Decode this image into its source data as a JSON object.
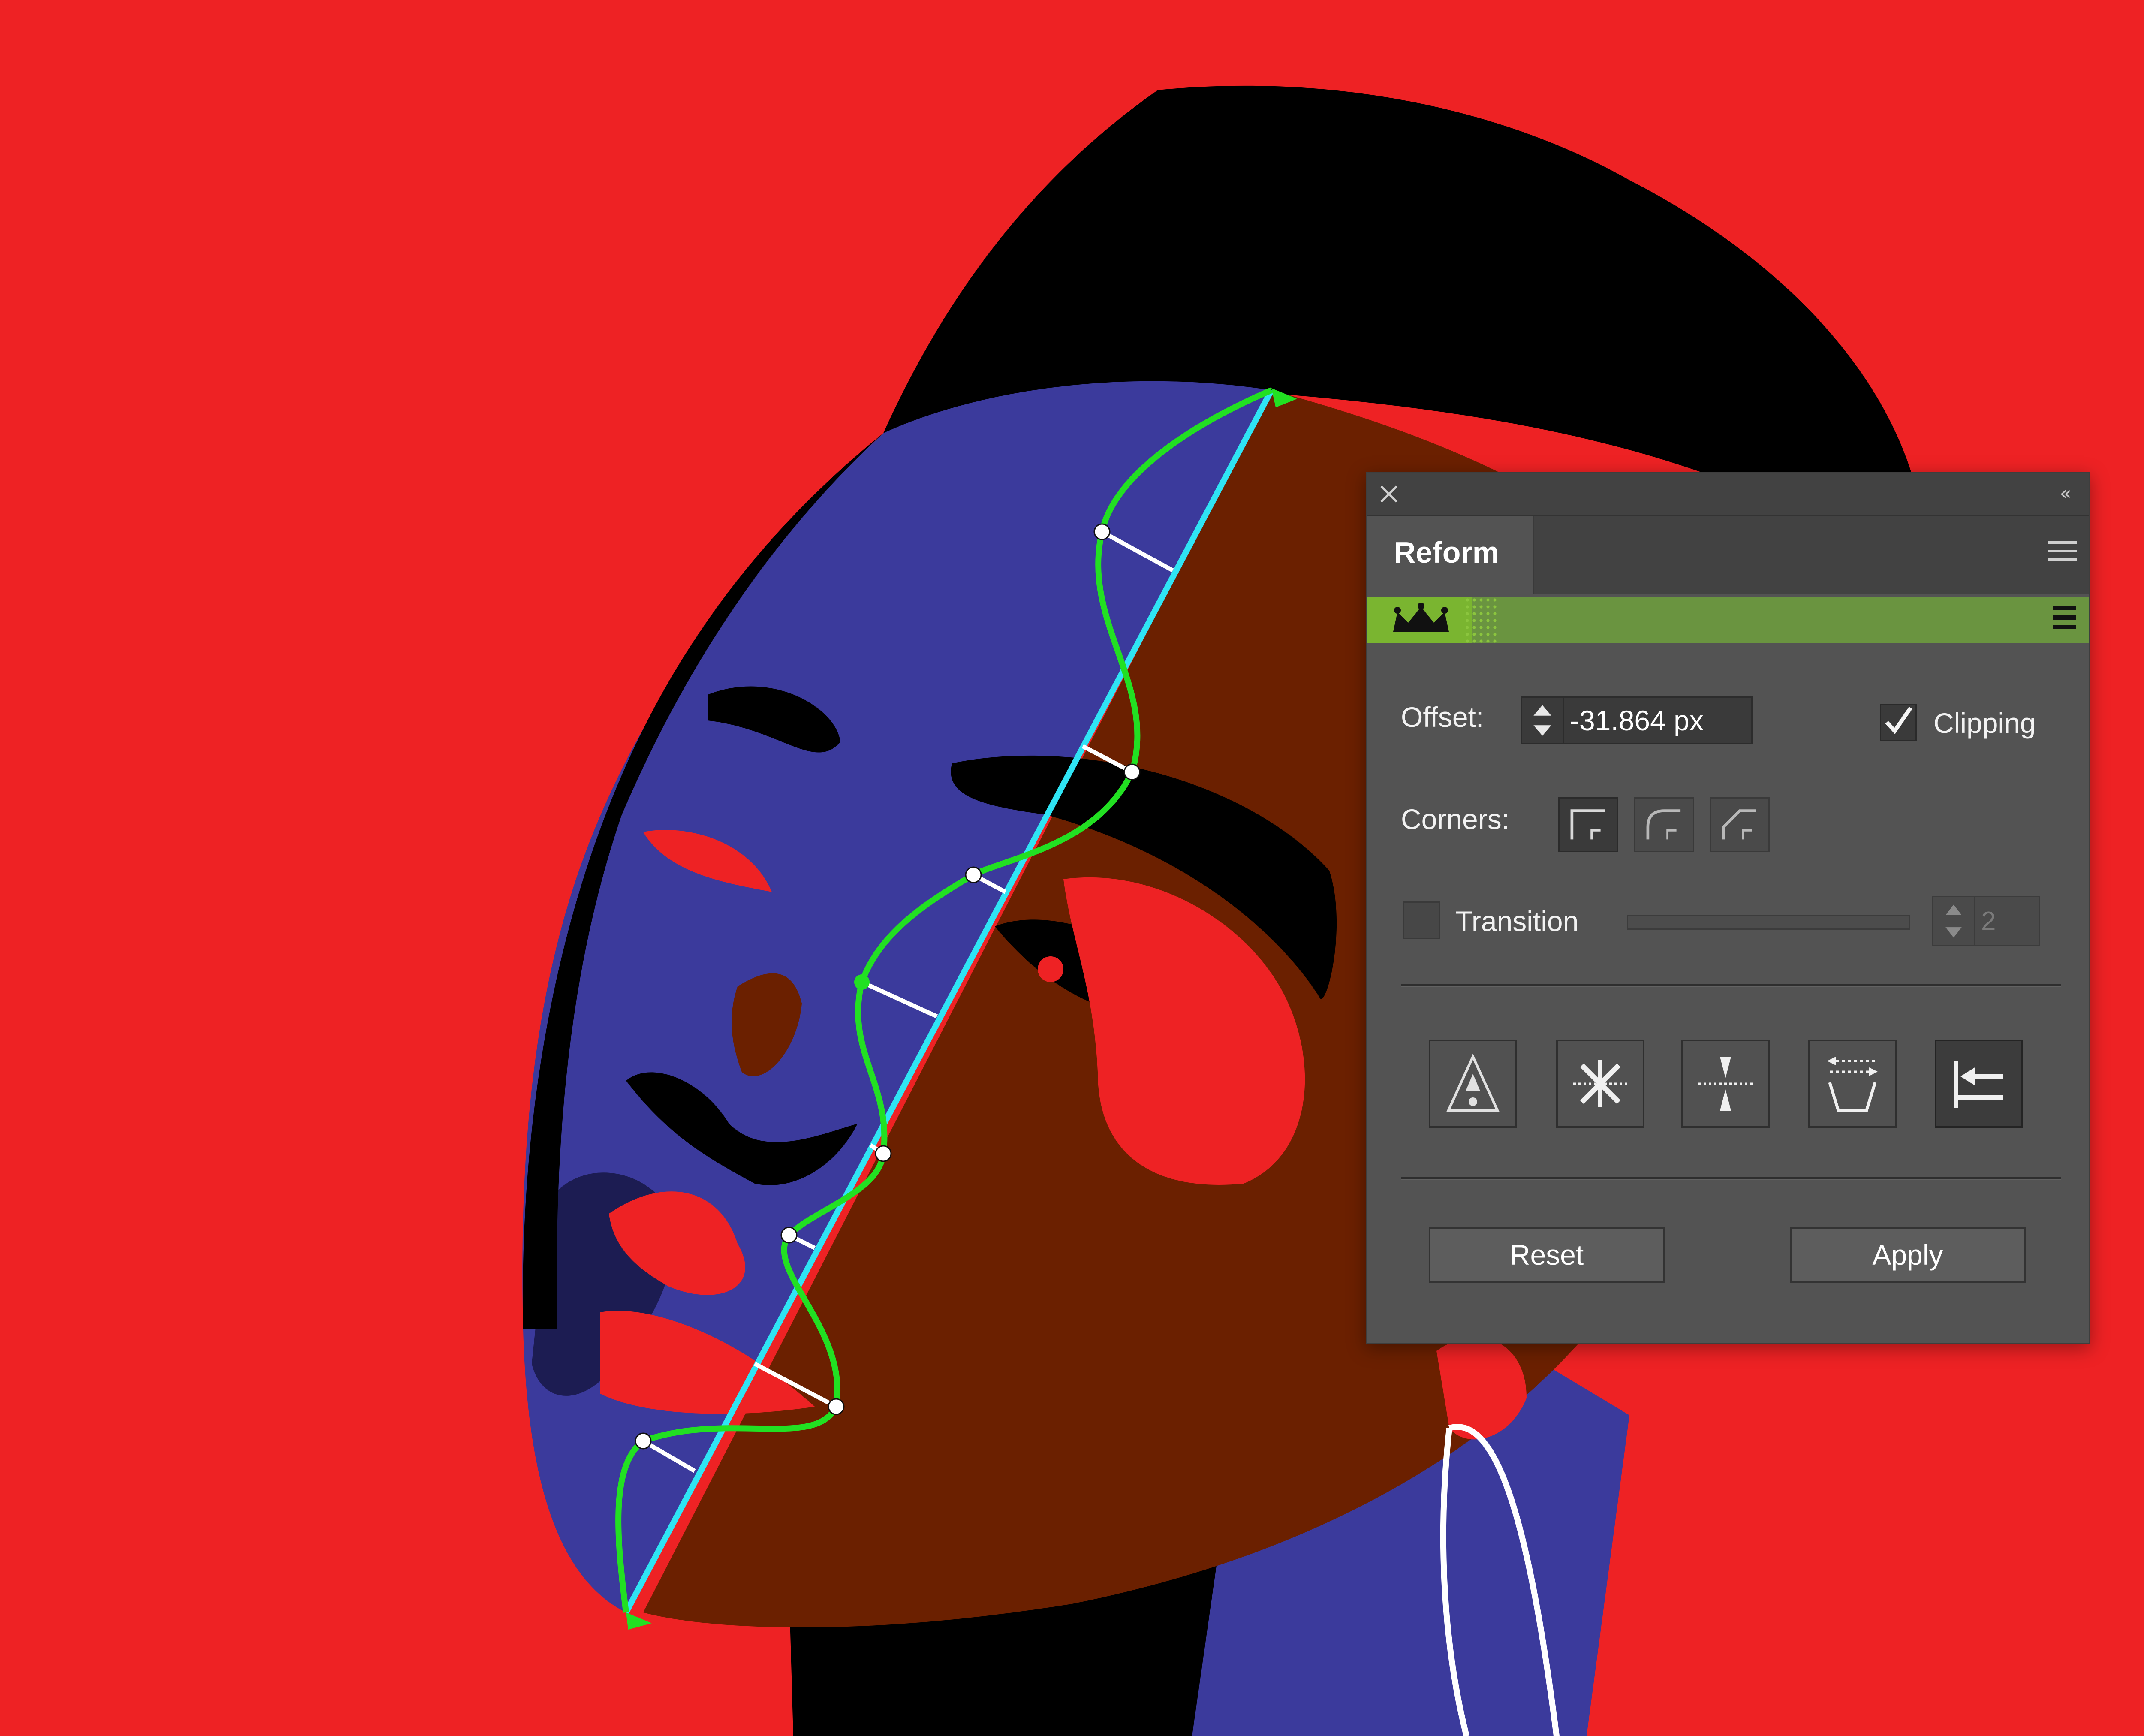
{
  "panel": {
    "title": "Reform",
    "offset": {
      "label": "Offset:",
      "value": "-31.864 px"
    },
    "clipping": {
      "label": "Clipping",
      "checked": true
    },
    "corners": {
      "label": "Corners:",
      "options": [
        "miter",
        "round",
        "bevel"
      ],
      "selected": "miter"
    },
    "transition": {
      "label": "Transition",
      "checked": false,
      "value": "2"
    },
    "modes": [
      "mode-1",
      "mode-2",
      "mode-3",
      "mode-4",
      "mode-5"
    ],
    "selected_mode": "mode-5",
    "buttons": {
      "reset": "Reset",
      "apply": "Apply"
    }
  },
  "icons": {
    "close": "close-icon",
    "collapse": "collapse-icon",
    "menu": "menu-icon",
    "crown": "crown-icon"
  },
  "colors": {
    "background": "#ee2224",
    "panel": "#535353",
    "accent_green": "#7ab530",
    "path_green": "#22e022",
    "path_cyan": "#2fe4f4",
    "skin_blue": "#3b3a9c",
    "skin_brown": "#6b2000"
  }
}
